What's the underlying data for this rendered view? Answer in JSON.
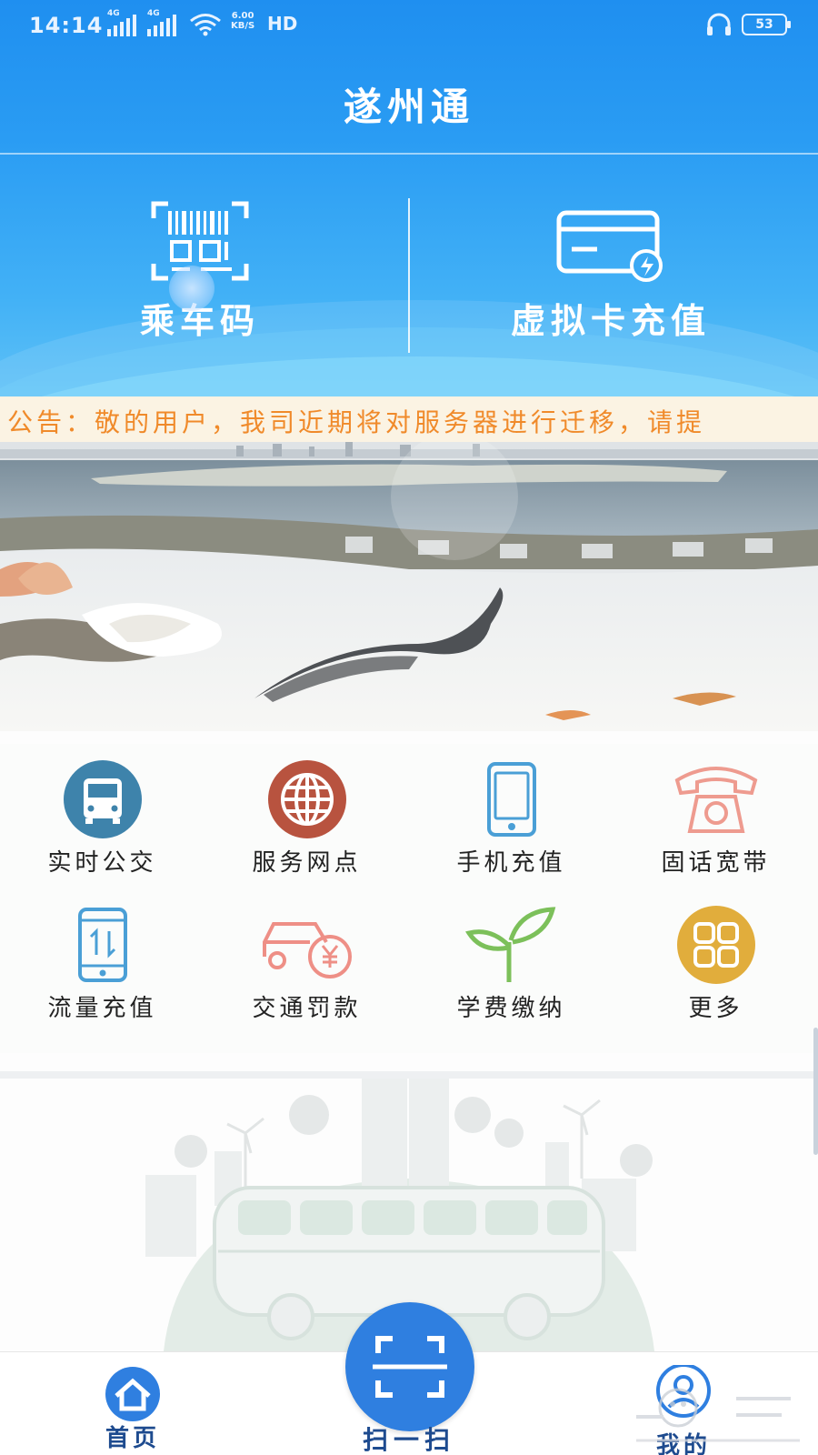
{
  "status_bar": {
    "time": "14:14",
    "signal1_tag": "4G",
    "signal2_tag": "4G",
    "net_speed_value": "6.00",
    "net_speed_unit": "KB/S",
    "hd": "HD",
    "battery": "53"
  },
  "header": {
    "title": "遂州通",
    "ride_code_label": "乘车码",
    "virtual_card_label": "虚拟卡充值"
  },
  "notice": {
    "text": "公告：敬的用户，我司近期将对服务器进行迁移，请提"
  },
  "services": [
    {
      "label": "实时公交",
      "icon": "bus-icon",
      "color": "#3e83ab"
    },
    {
      "label": "服务网点",
      "icon": "globe-icon",
      "color": "#b8533f"
    },
    {
      "label": "手机充值",
      "icon": "phone-icon",
      "color": "#4a9fd6"
    },
    {
      "label": "固话宽带",
      "icon": "telephone-icon",
      "color": "#ee9b8f"
    },
    {
      "label": "流量充值",
      "icon": "data-phone-icon",
      "color": "#4a9fd6"
    },
    {
      "label": "交通罚款",
      "icon": "car-fine-icon",
      "color": "#ee8f86"
    },
    {
      "label": "学费缴纳",
      "icon": "sprout-icon",
      "color": "#7cc05a"
    },
    {
      "label": "更多",
      "icon": "grid-more-icon",
      "color": "#e1ad3c"
    }
  ],
  "tabbar": {
    "home_label": "首页",
    "scan_label": "扫一扫",
    "mine_label": "我的"
  },
  "colors": {
    "header_blue": "#2a9cf3",
    "notice_text": "#f08a2a",
    "tab_text": "#1e4b8f",
    "scan_button": "#2f7fe0"
  }
}
